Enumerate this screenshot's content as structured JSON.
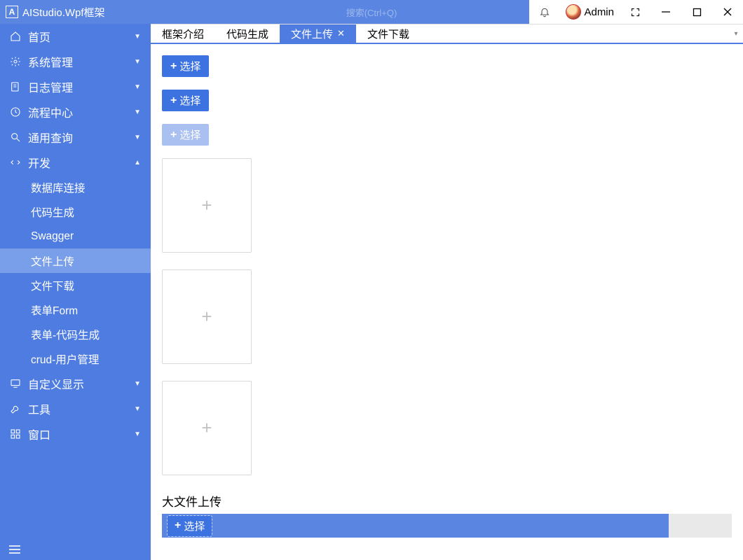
{
  "titlebar": {
    "app_title": "AIStudio.Wpf框架",
    "search_placeholder": "搜索(Ctrl+Q)",
    "user_name": "Admin"
  },
  "sidebar": {
    "items": [
      {
        "label": "首页",
        "icon": "home",
        "expanded": false
      },
      {
        "label": "系统管理",
        "icon": "gear",
        "expanded": false
      },
      {
        "label": "日志管理",
        "icon": "log",
        "expanded": false
      },
      {
        "label": "流程中心",
        "icon": "clock",
        "expanded": false
      },
      {
        "label": "通用查询",
        "icon": "search",
        "expanded": false
      },
      {
        "label": "开发",
        "icon": "code",
        "expanded": true
      },
      {
        "label": "自定义显示",
        "icon": "monitor",
        "expanded": false
      },
      {
        "label": "工具",
        "icon": "wrench",
        "expanded": false
      },
      {
        "label": "窗口",
        "icon": "grid",
        "expanded": false
      }
    ],
    "dev_children": [
      {
        "label": "数据库连接"
      },
      {
        "label": "代码生成"
      },
      {
        "label": "Swagger"
      },
      {
        "label": "文件上传",
        "active": true
      },
      {
        "label": "文件下载"
      },
      {
        "label": "表单Form"
      },
      {
        "label": "表单-代码生成"
      },
      {
        "label": "crud-用户管理"
      }
    ]
  },
  "tabs": [
    {
      "label": "框架介绍",
      "active": false
    },
    {
      "label": "代码生成",
      "active": false
    },
    {
      "label": "文件上传",
      "active": true
    },
    {
      "label": "文件下载",
      "active": false
    }
  ],
  "content": {
    "select_label": "选择",
    "big_upload_label": "大文件上传"
  }
}
